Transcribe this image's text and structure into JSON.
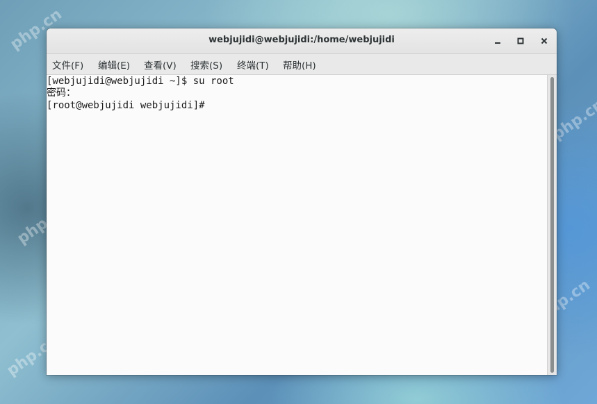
{
  "window": {
    "title": "webjujidi@webjujidi:/home/webjujidi"
  },
  "menu": {
    "items": [
      {
        "label": "文件(F)"
      },
      {
        "label": "编辑(E)"
      },
      {
        "label": "查看(V)"
      },
      {
        "label": "搜索(S)"
      },
      {
        "label": "终端(T)"
      },
      {
        "label": "帮助(H)"
      }
    ]
  },
  "terminal": {
    "lines": [
      "[webjujidi@webjujidi ~]$ su root",
      "密码：",
      "[root@webjujidi webjujidi]# "
    ]
  },
  "watermark": {
    "text": "php.cn"
  },
  "icons": {
    "minimize": "minimize-icon",
    "maximize": "maximize-icon",
    "close": "close-icon"
  }
}
